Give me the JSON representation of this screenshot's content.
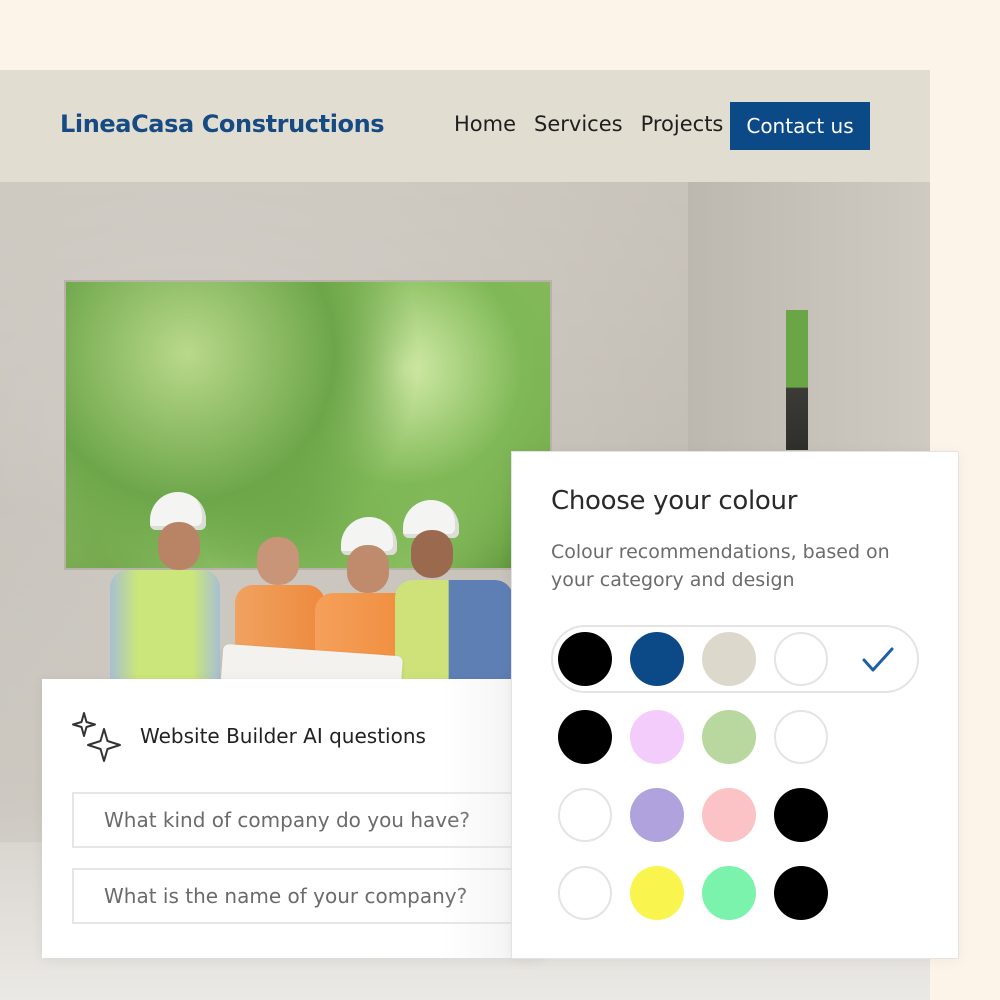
{
  "site": {
    "logo": "LineaCasa Constructions",
    "nav": [
      "Home",
      "Services",
      "Projects"
    ],
    "contact_label": "Contact us",
    "brand_color": "#0b4a87"
  },
  "ai_panel": {
    "title": "Website Builder AI questions",
    "icon": "sparkle-icon",
    "questions": [
      "What kind of company do you have?",
      "What is the name of your company?"
    ]
  },
  "colour_panel": {
    "title": "Choose your colour",
    "subtitle": "Colour recommendations, based on your category and design",
    "palettes": [
      {
        "selected": true,
        "colors": [
          "#000000",
          "#0b4a87",
          "#ddd8cc",
          "#ffffff"
        ]
      },
      {
        "selected": false,
        "colors": [
          "#000000",
          "#f4ccfb",
          "#b9d8a0",
          "#ffffff"
        ]
      },
      {
        "selected": false,
        "colors": [
          "#ffffff",
          "#b0a2dc",
          "#fbc3c5",
          "#000000"
        ]
      },
      {
        "selected": false,
        "colors": [
          "#ffffff",
          "#f9f54e",
          "#7cf3ad",
          "#000000"
        ]
      }
    ],
    "check_icon": "check-icon",
    "check_color": "#1f5fa6"
  }
}
